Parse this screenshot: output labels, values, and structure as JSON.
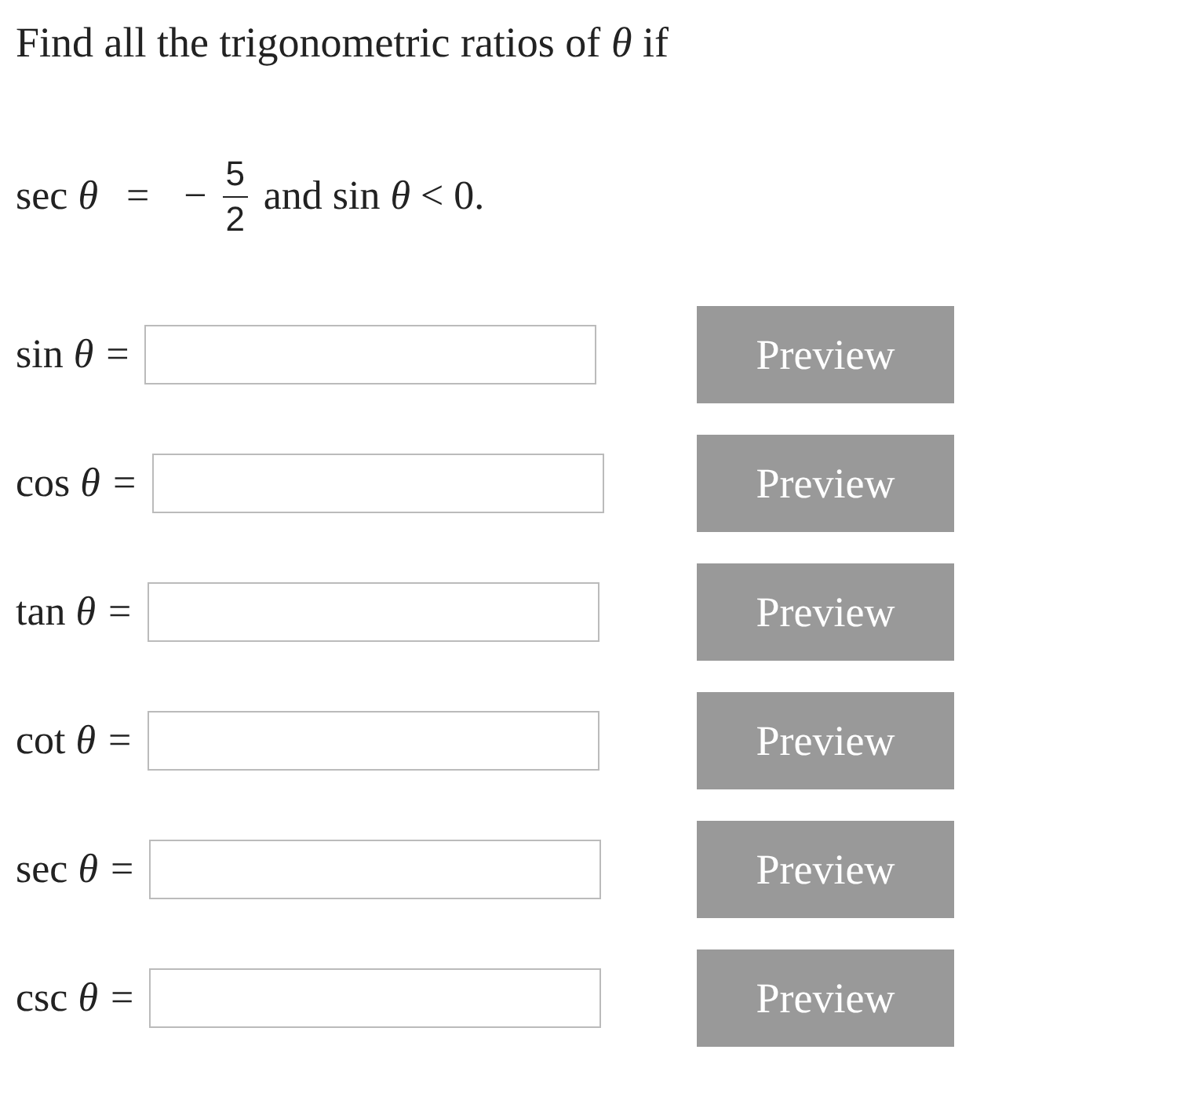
{
  "question": "Find all the trigonometric ratios of *θ* if",
  "condition": {
    "lhs": "sec *θ*",
    "op": "=",
    "sign": "−",
    "numerator": "5",
    "denominator": "2",
    "rest": "and sin *θ* < 0."
  },
  "answers": [
    {
      "label": "sin *θ*",
      "op": "=",
      "button": "Preview"
    },
    {
      "label": "cos *θ*",
      "op": "=",
      "button": "Preview"
    },
    {
      "label": "tan *θ*",
      "op": "=",
      "button": "Preview"
    },
    {
      "label": "cot *θ*",
      "op": "=",
      "button": "Preview"
    },
    {
      "label": "sec *θ*",
      "op": "=",
      "button": "Preview"
    },
    {
      "label": "csc *θ*",
      "op": "=",
      "button": "Preview"
    }
  ]
}
